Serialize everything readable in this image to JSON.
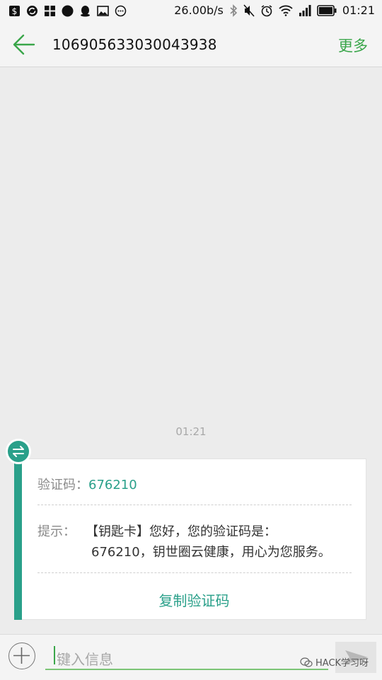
{
  "status_bar": {
    "left_icons": [
      "notification-icon",
      "sync-icon",
      "apps-icon",
      "dot-icon",
      "qq-icon",
      "image-icon",
      "message-icon"
    ],
    "net_speed": "26.00b/s",
    "right_icons": [
      "bluetooth-icon",
      "mute-icon",
      "alarm-icon",
      "wifi-icon",
      "signal-icon",
      "battery-icon"
    ],
    "clock": "01:21"
  },
  "header": {
    "sender": "106905633030043938",
    "more_label": "更多"
  },
  "conversation": {
    "timestamp": "01:21",
    "card": {
      "code_label": "验证码：",
      "code_value": "676210",
      "tip_label": "提示：",
      "tip_line1": "【钥匙卡】您好，您的验证码是：",
      "tip_line2": "676210，钥世圈云健康，用心为您服务。",
      "copy_label": "复制验证码"
    }
  },
  "composer": {
    "placeholder": "键入信息"
  },
  "watermark": "HACK学习呀",
  "colors": {
    "accent_green": "#3aa64a",
    "teal": "#2aa08a"
  }
}
